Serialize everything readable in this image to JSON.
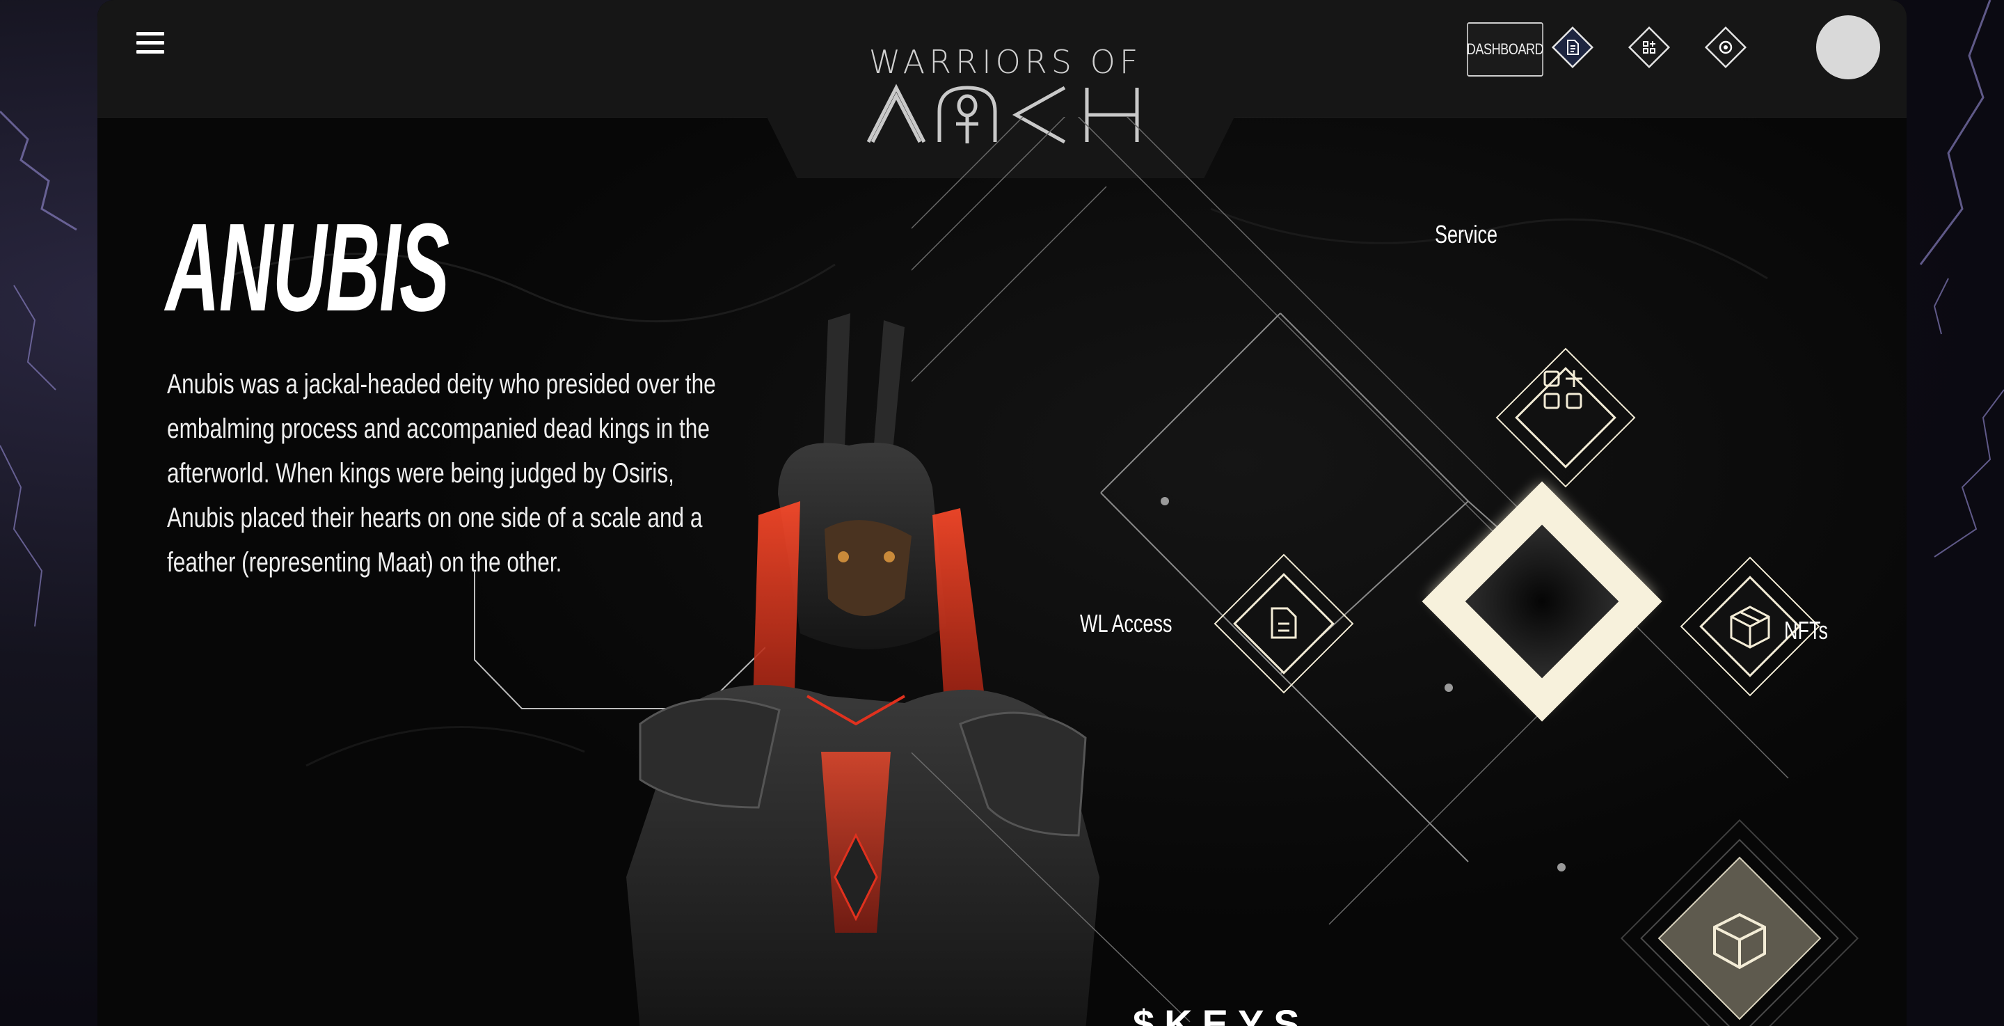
{
  "header": {
    "logo_top": "WARRIORS OF",
    "logo_bottom": "ANKH",
    "dashboard_label": "DASHBOARD",
    "nav_icons": [
      "document-icon",
      "apps-icon",
      "settings-icon"
    ]
  },
  "hero": {
    "title": "ANUBIS",
    "description": "Anubis was a jackal-headed deity who presided over the embalming process and accompanied dead kings in the afterworld. When kings were being judged by Osiris, Anubis placed their hearts on one side of a scale and a feather (representing Maat) on the other."
  },
  "diagram": {
    "service_label": "Service",
    "wl_label": "WL Access",
    "nfts_label": "NFTs"
  },
  "footer_peek": {
    "keys_label": "$KEYS"
  },
  "colors": {
    "accent": "#f3ecd6",
    "panel": "#070707",
    "topbar": "#161616",
    "armor_red": "#e0311e"
  }
}
